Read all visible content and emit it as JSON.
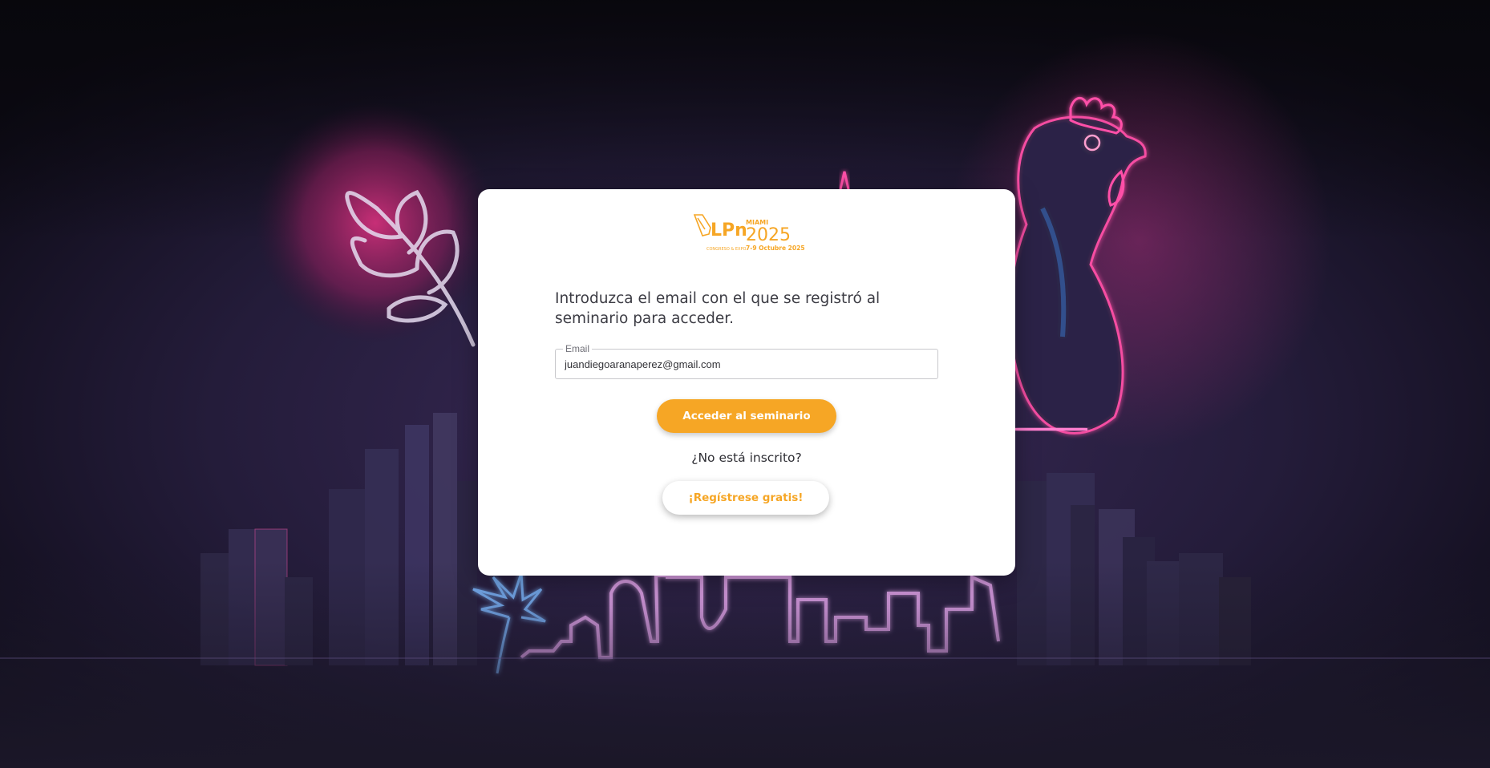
{
  "colors": {
    "accent": "#f6a625",
    "card_background": "#ffffff",
    "page_background": "#1c1830",
    "neon_pink": "#ff4fa8",
    "neon_blue": "#2fb4ff"
  },
  "logo": {
    "brand": "LPn",
    "city": "MIAMI",
    "year": "2025",
    "subtitle": "CONGRESO & EXPO",
    "dates": "7-9 Octubre 2025"
  },
  "login": {
    "instruction": "Introduzca el email con el que se registró al seminario para acceder.",
    "email_label": "Email",
    "email_value": "juandiegoaranaperez@gmail.com",
    "submit_label": "Acceder al seminario",
    "not_registered_text": "¿No está inscrito?",
    "register_label": "¡Regístrese gratis!"
  },
  "background": {
    "description_icons": [
      "neon-city-skyline",
      "neon-rooster",
      "neon-leaf",
      "neon-palm-tree"
    ]
  }
}
